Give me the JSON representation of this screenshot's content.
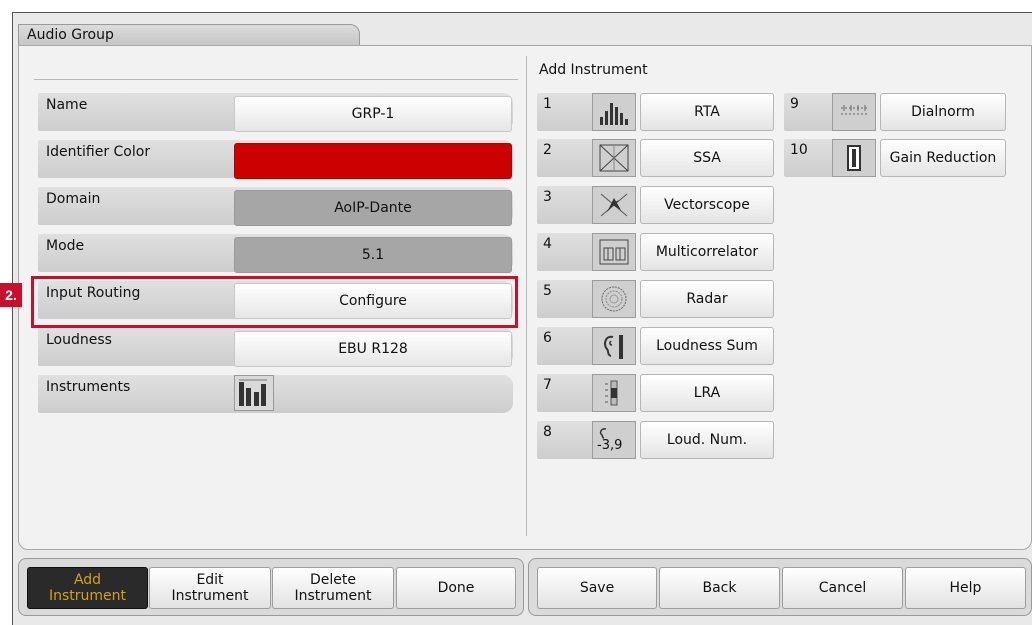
{
  "window": {
    "title": "Audio Group"
  },
  "marker": {
    "label": "2."
  },
  "properties": {
    "name": {
      "label": "Name",
      "value": "GRP-1"
    },
    "identifier_color": {
      "label": "Identifier Color",
      "color": "#cc0000"
    },
    "domain": {
      "label": "Domain",
      "value": "AoIP-Dante"
    },
    "mode": {
      "label": "Mode",
      "value": "5.1"
    },
    "input_routing": {
      "label": "Input Routing",
      "value": "Configure"
    },
    "loudness": {
      "label": "Loudness",
      "value": "EBU R128"
    },
    "instruments": {
      "label": "Instruments",
      "icon": "bargraph-icon"
    }
  },
  "add_instrument": {
    "title": "Add Instrument",
    "items": [
      {
        "num": "1",
        "label": "RTA",
        "icon": "rta-icon"
      },
      {
        "num": "2",
        "label": "SSA",
        "icon": "ssa-icon"
      },
      {
        "num": "3",
        "label": "Vectorscope",
        "icon": "vectorscope-icon"
      },
      {
        "num": "4",
        "label": "Multicorrelator",
        "icon": "multicorrelator-icon"
      },
      {
        "num": "5",
        "label": "Radar",
        "icon": "radar-icon"
      },
      {
        "num": "6",
        "label": "Loudness Sum",
        "icon": "loudness-sum-icon"
      },
      {
        "num": "7",
        "label": "LRA",
        "icon": "lra-icon"
      },
      {
        "num": "8",
        "label": "Loud. Num.",
        "icon": "loudness-num-icon",
        "icon_text": "-3,9"
      },
      {
        "num": "9",
        "label": "Dialnorm",
        "icon": "dialnorm-icon"
      },
      {
        "num": "10",
        "label": "Gain Reduction",
        "icon": "gain-reduction-icon"
      }
    ]
  },
  "toolbar": {
    "add_line1": "Add",
    "add_line2": "Instrument",
    "edit_line1": "Edit",
    "edit_line2": "Instrument",
    "delete_line1": "Delete",
    "delete_line2": "Instrument",
    "done": "Done",
    "save": "Save",
    "back": "Back",
    "cancel": "Cancel",
    "help": "Help"
  },
  "colors": {
    "accent_red": "#c8102e",
    "active_text": "#d4a017"
  }
}
